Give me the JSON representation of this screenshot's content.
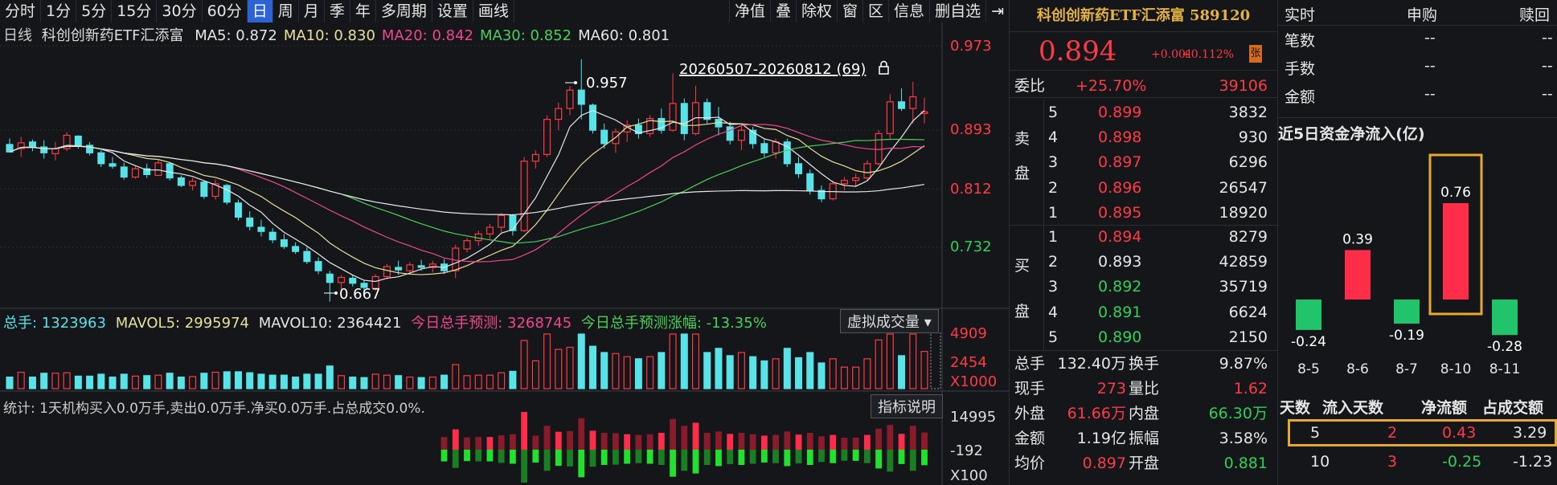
{
  "toolbar": {
    "left": [
      "分时",
      "1分",
      "5分",
      "15分",
      "30分",
      "60分",
      "日",
      "周",
      "月",
      "季",
      "年",
      "多周期",
      "设置",
      "画线"
    ],
    "active": "日",
    "right": [
      "净值",
      "叠",
      "除权",
      "窗",
      "区",
      "信息",
      "删自选",
      "⇥"
    ]
  },
  "kline": {
    "period": "日线",
    "name": "科创创新药ETF汇添富",
    "ma": [
      {
        "label": "MA5: 0.872",
        "color": "#e6e6e6"
      },
      {
        "label": "MA10: 0.830",
        "color": "#e7e09a"
      },
      {
        "label": "MA20: 0.842",
        "color": "#f0478e"
      },
      {
        "label": "MA30: 0.852",
        "color": "#4ad05a"
      },
      {
        "label": "MA60: 0.801",
        "color": "#e6e6e6"
      }
    ],
    "range_label": "20260507-20260812 (69)",
    "high_label": "0.957",
    "low_label": "0.667",
    "yticks": [
      "0.973",
      "0.893",
      "0.812",
      "0.732"
    ]
  },
  "volume": {
    "total": "总手: 1323963",
    "mavol5": "MAVOL5: 2995974",
    "mavol10": "MAVOL10: 2364421",
    "pred": "今日总手预测: 3268745",
    "pred_rise": "今日总手预测涨幅: -13.35%",
    "btn": "虚拟成交量 ▾",
    "yticks": [
      "4909",
      "2454",
      "X1000"
    ]
  },
  "stat": {
    "text": "统计: 1天机构买入0.0万手,卖出0.0万手.净买0.0万手.占总成交0.0%.",
    "btn": "指标说明",
    "yticks": [
      "14995",
      "-192",
      "X100"
    ]
  },
  "quote": {
    "title": "科创创新药ETF汇添富 589120",
    "price": "0.894",
    "chg": "+0.001",
    "chgp": "+0.112%",
    "zhang": "张",
    "weibi_label": "委比",
    "weibi": "+25.70%",
    "weicha": "39106",
    "sell_label": [
      "卖",
      "盘"
    ],
    "buy_label": [
      "买",
      "盘"
    ],
    "sells": [
      {
        "n": "5",
        "p": "0.899",
        "v": "3832"
      },
      {
        "n": "4",
        "p": "0.898",
        "v": "930"
      },
      {
        "n": "3",
        "p": "0.897",
        "v": "6296"
      },
      {
        "n": "2",
        "p": "0.896",
        "v": "26547"
      },
      {
        "n": "1",
        "p": "0.895",
        "v": "18920"
      }
    ],
    "buys": [
      {
        "n": "1",
        "p": "0.894",
        "v": "8279"
      },
      {
        "n": "2",
        "p": "0.893",
        "v": "42859"
      },
      {
        "n": "3",
        "p": "0.892",
        "v": "35719"
      },
      {
        "n": "4",
        "p": "0.891",
        "v": "6624"
      },
      {
        "n": "5",
        "p": "0.890",
        "v": "2150"
      }
    ],
    "stats": [
      {
        "k1": "总手",
        "v1": "132.40万",
        "k2": "换手",
        "v2": "9.87%"
      },
      {
        "k1": "现手",
        "v1": "273",
        "k2": "量比",
        "v2": "1.62"
      },
      {
        "k1": "外盘",
        "v1": "61.66万",
        "k2": "内盘",
        "v2": "66.30万"
      },
      {
        "k1": "金额",
        "v1": "1.19亿",
        "k2": "振幅",
        "v2": "3.58%"
      },
      {
        "k1": "均价",
        "v1": "0.897",
        "k2": "开盘",
        "v2": "0.881"
      }
    ]
  },
  "side": {
    "head": [
      "实时",
      "申购",
      "赎回"
    ],
    "rows": [
      {
        "k": "笔数",
        "a": "--",
        "b": "--"
      },
      {
        "k": "手数",
        "a": "--",
        "b": "--"
      },
      {
        "k": "金额",
        "a": "--",
        "b": "--"
      }
    ],
    "flow_title": "近5日资金净流入(亿)",
    "table_head": [
      "天数",
      "流入天数",
      "净流额",
      "占成交额"
    ],
    "table_rows": [
      {
        "d": "5",
        "in": "2",
        "net": "0.43",
        "pct": "3.29"
      },
      {
        "d": "10",
        "in": "3",
        "net": "-0.25",
        "pct": "-1.23"
      }
    ]
  },
  "chart_data": {
    "type": "bar",
    "categories": [
      "8-5",
      "8-6",
      "8-7",
      "8-10",
      "8-11"
    ],
    "values": [
      -0.24,
      0.39,
      -0.19,
      0.76,
      -0.28
    ],
    "title": "近5日资金净流入(亿)",
    "highlight": "8-10",
    "colors": {
      "pos": "#ff2d4a",
      "neg": "#21c46a"
    }
  }
}
